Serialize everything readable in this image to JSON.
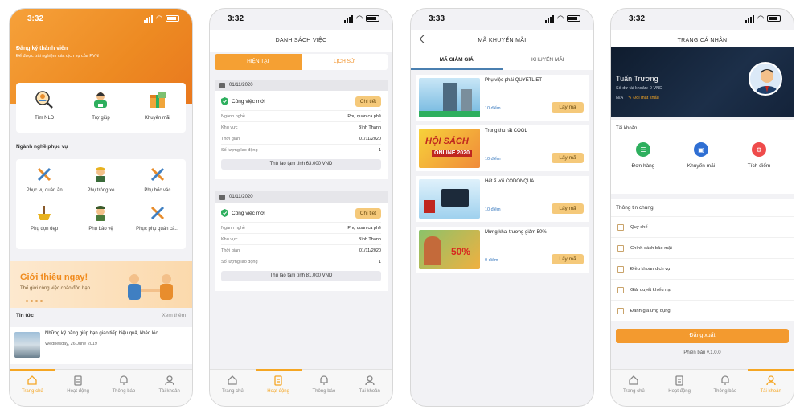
{
  "colors": {
    "brand_orange": "#f5a623",
    "button_orange": "#f39a2f",
    "link_blue": "#3a7abf",
    "profile_dark": "#14233a"
  },
  "status": [
    {
      "time": "3:32"
    },
    {
      "time": "3:32"
    },
    {
      "time": "3:33"
    },
    {
      "time": "3:32"
    }
  ],
  "tabs": [
    {
      "label": "Trang chủ",
      "icon": "home-icon"
    },
    {
      "label": "Hoạt động",
      "icon": "clipboard-icon"
    },
    {
      "label": "Thông báo",
      "icon": "bell-icon"
    },
    {
      "label": "Tài khoản",
      "icon": "user-icon"
    }
  ],
  "home": {
    "register_title": "Đăng ký thành viên",
    "register_sub": "Để được trải nghiệm các dịch vụ của PVN",
    "quick": [
      {
        "label": "Tìm NLD",
        "icon": "search-worker-icon"
      },
      {
        "label": "Trợ giúp",
        "icon": "support-agent-icon"
      },
      {
        "label": "Khuyến mãi",
        "icon": "gift-icon"
      }
    ],
    "section_title": "Ngành nghề phục vụ",
    "services": [
      {
        "label": "Phục vụ quán ăn",
        "icon": "tools-icon"
      },
      {
        "label": "Phụ trông xe",
        "icon": "worker-icon"
      },
      {
        "label": "Phụ bốc vác",
        "icon": "tools-icon"
      },
      {
        "label": "Phụ dọn dẹp",
        "icon": "cleaning-icon"
      },
      {
        "label": "Phụ bảo vệ",
        "icon": "guard-icon"
      },
      {
        "label": "Phục phụ quán cà...",
        "icon": "tools-icon"
      }
    ],
    "banner_title": "Giới thiệu ngay!",
    "banner_sub": "Thế giới công việc chào đón bạn",
    "news_title": "Tin tức",
    "news_more": "Xem thêm",
    "news": {
      "title": "Những kỹ năng giúp bạn giao tiếp hiệu quả, khéo léo",
      "date": "Wednesday, 26 June 2019"
    }
  },
  "jobs": {
    "title": "Danh sách việc",
    "tab_current": "HIỆN TẠI",
    "tab_history": "LỊCH SỬ",
    "items": [
      {
        "date": "01/11/2020",
        "title": "Công việc mới",
        "detail": "Chi tiết",
        "rows": [
          {
            "k": "Ngành nghề",
            "v": "Phụ quán cà phê"
          },
          {
            "k": "Khu vực",
            "v": "Bình Thạnh"
          },
          {
            "k": "Thời gian",
            "v": "01/11/2020"
          },
          {
            "k": "Số lượng lao động",
            "v": "1"
          }
        ],
        "salary": "Thù lao tạm tính 63.000 VND"
      },
      {
        "date": "01/11/2020",
        "title": "Công việc mới",
        "detail": "Chi tiết",
        "rows": [
          {
            "k": "Ngành nghề",
            "v": "Phụ quán cà phê"
          },
          {
            "k": "Khu vực",
            "v": "Bình Thạnh"
          },
          {
            "k": "Thời gian",
            "v": "01/11/2020"
          },
          {
            "k": "Số lượng lao động",
            "v": "1"
          }
        ],
        "salary": "Thù lao tạm tính 81.000 VND"
      }
    ]
  },
  "promos": {
    "title": "Mã khuyến mãi",
    "tab_codes": "MÃ GIẢM GIÁ",
    "tab_promos": "KHUYẾN MÃI",
    "button": "Lấy mã",
    "items": [
      {
        "title": "Phụ việc phải QUYETLIET",
        "points": "10 điểm"
      },
      {
        "title": "Trung thu rất COOL",
        "points": "10 điểm"
      },
      {
        "title": "Hết ế với CODONQUA",
        "points": "10 điểm"
      },
      {
        "title": "Mừng khai trương giảm 50%",
        "points": "0 điểm"
      }
    ]
  },
  "profile": {
    "title": "Trang cá nhân",
    "name": "Tuấn Trương",
    "balance": "Số dư tài khoản: 0 VND",
    "password": "N/A",
    "change_password": "Đổi mật khẩu",
    "account_title": "Tài khoản",
    "account_items": [
      {
        "label": "Đơn hàng",
        "icon": "list-icon",
        "color": "#2eaf5e"
      },
      {
        "label": "Khuyến mãi",
        "icon": "gift-icon",
        "color": "#2f6fd3"
      },
      {
        "label": "Tích điểm",
        "icon": "gear-icon",
        "color": "#ef4b4b"
      }
    ],
    "info_title": "Thông tin chung",
    "info_items": [
      "Quy chế",
      "Chính sách bảo mật",
      "Điều khoản dịch vụ",
      "Giải quyết khiếu nại",
      "Đánh giá ứng dụng"
    ],
    "logout": "Đăng xuất",
    "version": "Phiên bản v.1.0.0"
  }
}
